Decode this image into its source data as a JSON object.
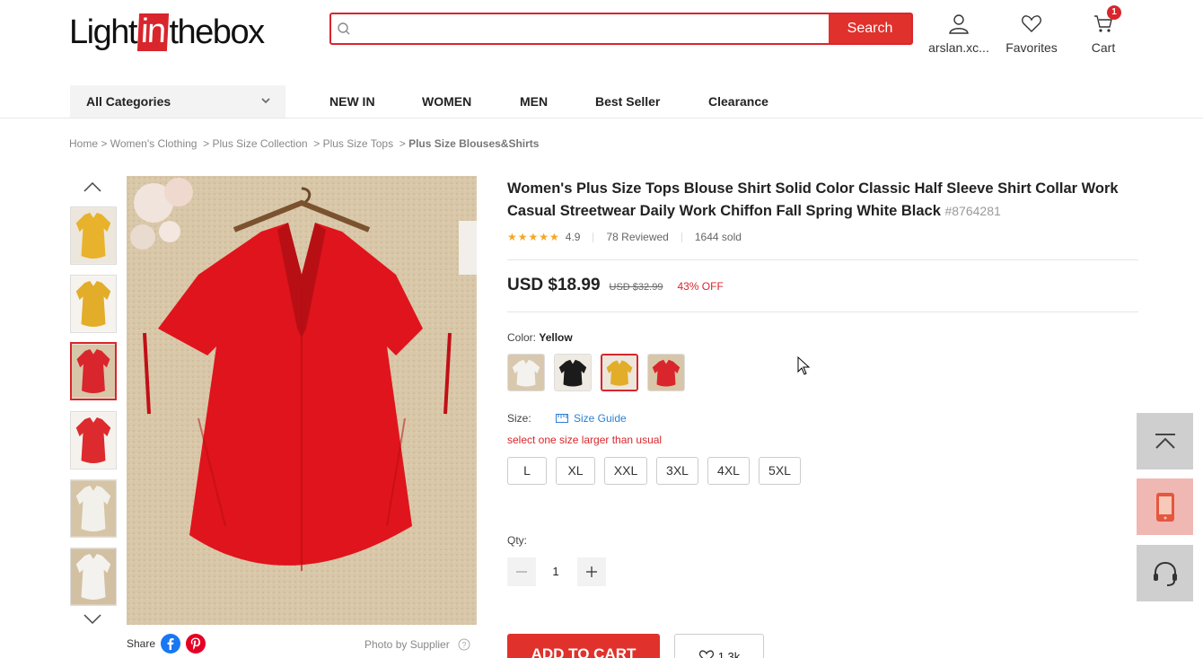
{
  "header": {
    "logo": {
      "pre": "Light",
      "mid": "in",
      "post": "thebox"
    },
    "search": {
      "placeholder": "",
      "button": "Search"
    },
    "account": "arslan.xc...",
    "favorites": "Favorites",
    "cart": {
      "label": "Cart",
      "count": "1"
    }
  },
  "nav": {
    "categories": "All Categories",
    "items": [
      "NEW IN",
      "WOMEN",
      "MEN",
      "Best Seller",
      "Clearance"
    ]
  },
  "breadcrumb": [
    "Home",
    "Women's Clothing",
    "Plus Size Collection",
    "Plus Size Tops",
    "Plus Size Blouses&Shirts"
  ],
  "gallery": {
    "thumbs": [
      "#e8b22c",
      "#e2ad28",
      "#d8262c",
      "#dd2a2e",
      "#f2f0ea",
      "#f4f2ee"
    ],
    "selected": 2
  },
  "share": {
    "label": "Share",
    "photo_by": "Photo by Supplier"
  },
  "product": {
    "title": "Women's Plus Size Tops Blouse Shirt Solid Color Classic Half Sleeve Shirt Collar Work Casual Streetwear Daily Work Chiffon Fall Spring White Black",
    "sku": "#8764281",
    "stars": "★★★★★",
    "rating": "4.9",
    "reviews": "78 Reviewed",
    "sold": "1644 sold",
    "price": "USD $18.99",
    "old_price": "USD $32.99",
    "discount": "43% OFF",
    "color_label": "Color:",
    "color_value": "Yellow",
    "colors": [
      "#f4f2ee",
      "#1b1b1b",
      "#e2ad28",
      "#d8262c"
    ],
    "color_selected": 2,
    "size_label": "Size:",
    "size_guide": "Size Guide",
    "size_tip": "select one size larger than usual",
    "sizes": [
      "L",
      "XL",
      "XXL",
      "3XL",
      "4XL",
      "5XL"
    ],
    "qty_label": "Qty:",
    "qty": "1",
    "add_to_cart": "ADD TO CART",
    "fav_count": "1.3k"
  }
}
